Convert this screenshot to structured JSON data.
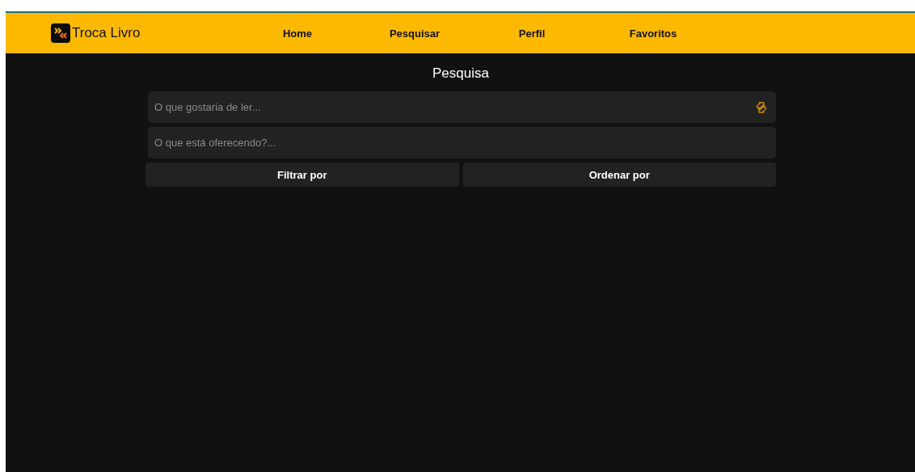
{
  "header": {
    "brand": "Troca Livro",
    "nav": [
      {
        "label": "Home"
      },
      {
        "label": "Pesquisar"
      },
      {
        "label": "Perfil"
      },
      {
        "label": "Favoritos"
      }
    ]
  },
  "search": {
    "title": "Pesquisa",
    "fields": [
      {
        "placeholder": "O que gostaria de ler...",
        "swap_icon": true
      },
      {
        "placeholder": "O que está oferecendo?...",
        "swap_icon": false
      }
    ],
    "buttons": [
      {
        "label": "Filtrar por"
      },
      {
        "label": "Ordenar por"
      }
    ]
  }
}
